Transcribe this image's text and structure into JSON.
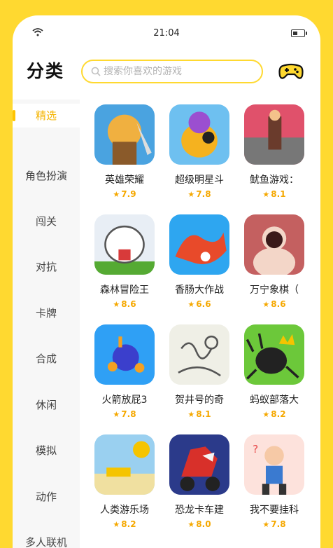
{
  "status": {
    "time": "21:04",
    "battery_level": 0.45
  },
  "header": {
    "title": "分类",
    "search_placeholder": "搜索你喜欢的游戏"
  },
  "sidebar": {
    "items": [
      {
        "label": "精选",
        "active": true
      },
      {
        "label": "角色扮演"
      },
      {
        "label": "闯关"
      },
      {
        "label": "对抗"
      },
      {
        "label": "卡牌"
      },
      {
        "label": "合成"
      },
      {
        "label": "休闲"
      },
      {
        "label": "模拟"
      },
      {
        "label": "动作"
      },
      {
        "label": "多人联机"
      }
    ]
  },
  "games": [
    {
      "name": "英雄荣耀",
      "rating": "7.9",
      "icon": "hero-warrior-icon",
      "colors": [
        "#4aa3e0",
        "#f0b040",
        "#8a5a2a"
      ]
    },
    {
      "name": "超级明星斗",
      "rating": "7.8",
      "icon": "star-fighter-icon",
      "colors": [
        "#6ec0f0",
        "#9b4fd0",
        "#f5b21f"
      ]
    },
    {
      "name": "鱿鱼游戏：",
      "rating": "8.1",
      "icon": "squid-game-icon",
      "colors": [
        "#e0516b",
        "#6a3b2c",
        "#f4c28a"
      ]
    },
    {
      "name": "森林冒险王",
      "rating": "8.6",
      "icon": "forest-dog-icon",
      "colors": [
        "#e8eef5",
        "#555555",
        "#d83a3a"
      ]
    },
    {
      "name": "香肠大作战",
      "rating": "6.6",
      "icon": "sausage-battle-icon",
      "colors": [
        "#2ea6f0",
        "#e84a2a",
        "#ffffff"
      ]
    },
    {
      "name": "万宁象棋（",
      "rating": "8.6",
      "icon": "chess-lady-icon",
      "colors": [
        "#c46060",
        "#f3d6c8",
        "#3a1a1a"
      ]
    },
    {
      "name": "火箭放屁3",
      "rating": "7.8",
      "icon": "rocket-blob-icon",
      "colors": [
        "#2fa0f5",
        "#3b3fcc",
        "#f5a022"
      ]
    },
    {
      "name": "贺井号的奇",
      "rating": "8.1",
      "icon": "doodle-sketch-icon",
      "colors": [
        "#efefe6",
        "#555555",
        "#999999"
      ]
    },
    {
      "name": "蚂蚁部落大",
      "rating": "8.2",
      "icon": "spider-king-icon",
      "colors": [
        "#6cc83a",
        "#222222",
        "#f5c400"
      ]
    },
    {
      "name": "人类游乐场",
      "rating": "8.2",
      "icon": "playground-icon",
      "colors": [
        "#9ad0f0",
        "#f5c400",
        "#444444"
      ]
    },
    {
      "name": "恐龙卡车建",
      "rating": "8.0",
      "icon": "dino-truck-icon",
      "colors": [
        "#2b3a8a",
        "#d8302a",
        "#f5f5f5"
      ]
    },
    {
      "name": "我不要挂科",
      "rating": "7.8",
      "icon": "exam-escape-icon",
      "colors": [
        "#fde2dc",
        "#3a7ad0",
        "#e84a4a"
      ]
    }
  ]
}
